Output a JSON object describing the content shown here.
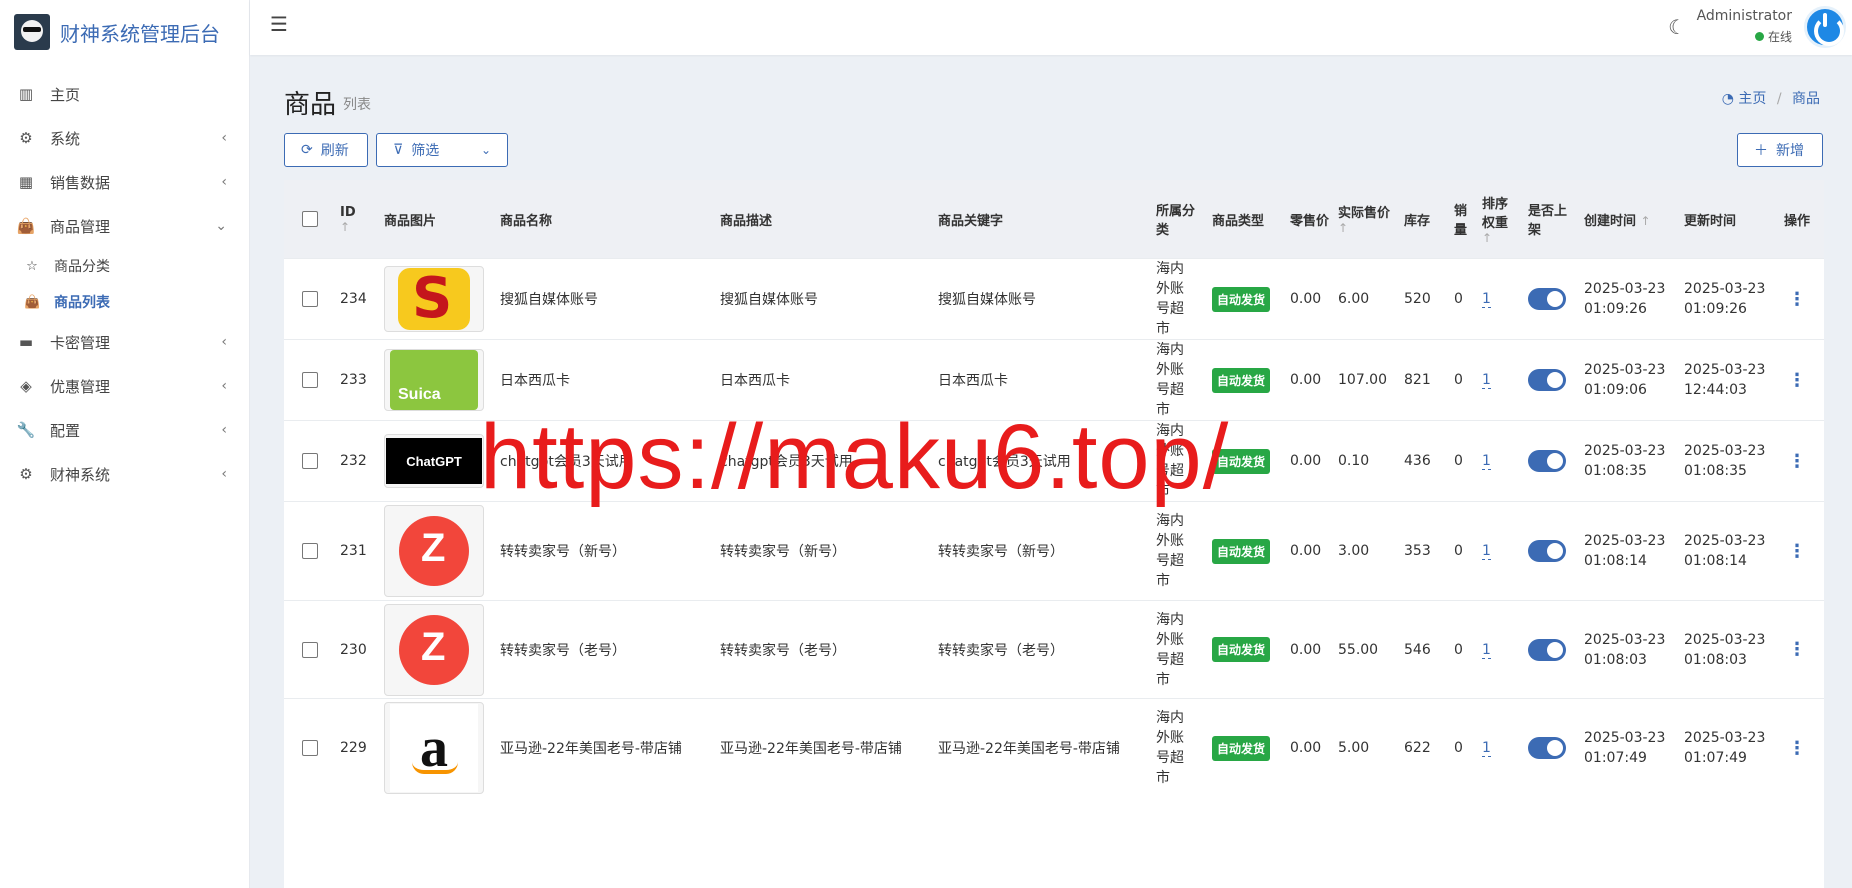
{
  "brand": {
    "title": "财神系统管理后台"
  },
  "sidebar": {
    "items": [
      {
        "icon": "bar-chart-icon",
        "glyph": "▥",
        "label": "主页"
      },
      {
        "icon": "gear-icon",
        "glyph": "⚙",
        "label": "系统"
      },
      {
        "icon": "table-icon",
        "glyph": "▦",
        "label": "销售数据"
      },
      {
        "icon": "shopping-bag-icon",
        "glyph": "👜",
        "label": "商品管理"
      },
      {
        "icon": "card-icon",
        "glyph": "▬",
        "label": "卡密管理"
      },
      {
        "icon": "diamond-icon",
        "glyph": "◈",
        "label": "优惠管理"
      },
      {
        "icon": "wrench-icon",
        "glyph": "🔧",
        "label": "配置"
      },
      {
        "icon": "gear-icon",
        "glyph": "⚙",
        "label": "财神系统"
      }
    ],
    "sub_items": [
      {
        "icon": "star-icon",
        "glyph": "☆",
        "label": "商品分类"
      },
      {
        "icon": "shopping-bag-icon",
        "glyph": "👜",
        "label": "商品列表"
      }
    ]
  },
  "header": {
    "user_name": "Administrator",
    "user_status": "在线",
    "status_color": "#28a745"
  },
  "page": {
    "title": "商品",
    "subtitle": "列表"
  },
  "breadcrumb": {
    "home": "主页",
    "current": "商品"
  },
  "toolbar": {
    "refresh": "刷新",
    "filter": "筛选",
    "add": "新增"
  },
  "table": {
    "headers": {
      "id": "ID",
      "img": "商品图片",
      "name": "商品名称",
      "desc": "商品描述",
      "kw": "商品关键字",
      "cat": "所属分类",
      "type": "商品类型",
      "retail": "零售价",
      "actual": "实际售价",
      "stock": "库存",
      "sales": "销量",
      "sort": "排序权重",
      "on_shelf": "是否上架",
      "created": "创建时间",
      "updated": "更新时间",
      "op": "操作"
    },
    "rows": [
      {
        "id": "234",
        "img": "sohu",
        "name": "搜狐自媒体账号",
        "desc": "搜狐自媒体账号",
        "kw": "搜狐自媒体账号",
        "cat": "海内外账号超市",
        "type": "自动发货",
        "retail": "0.00",
        "actual": "6.00",
        "stock": "520",
        "sales": "0",
        "sort": "1",
        "created_d": "2025-03-23",
        "created_t": "01:09:26",
        "updated_d": "2025-03-23",
        "updated_t": "01:09:26"
      },
      {
        "id": "233",
        "img": "suica",
        "name": "日本西瓜卡",
        "desc": "日本西瓜卡",
        "kw": "日本西瓜卡",
        "cat": "海内外账号超市",
        "type": "自动发货",
        "retail": "0.00",
        "actual": "107.00",
        "stock": "821",
        "sales": "0",
        "sort": "1",
        "created_d": "2025-03-23",
        "created_t": "01:09:06",
        "updated_d": "2025-03-23",
        "updated_t": "12:44:03"
      },
      {
        "id": "232",
        "img": "gpt",
        "name": "chatgpt会员3天试用",
        "desc": "chatgpt会员3天试用",
        "kw": "chatgpt会员3天试用",
        "cat": "海内外账号超市",
        "type": "自动发货",
        "retail": "0.00",
        "actual": "0.10",
        "stock": "436",
        "sales": "0",
        "sort": "1",
        "created_d": "2025-03-23",
        "created_t": "01:08:35",
        "updated_d": "2025-03-23",
        "updated_t": "01:08:35"
      },
      {
        "id": "231",
        "img": "zz",
        "name": "转转卖家号（新号）",
        "desc": "转转卖家号（新号）",
        "kw": "转转卖家号（新号）",
        "cat": "海内外账号超市",
        "type": "自动发货",
        "retail": "0.00",
        "actual": "3.00",
        "stock": "353",
        "sales": "0",
        "sort": "1",
        "created_d": "2025-03-23",
        "created_t": "01:08:14",
        "updated_d": "2025-03-23",
        "updated_t": "01:08:14"
      },
      {
        "id": "230",
        "img": "zz",
        "name": "转转卖家号（老号）",
        "desc": "转转卖家号（老号）",
        "kw": "转转卖家号（老号）",
        "cat": "海内外账号超市",
        "type": "自动发货",
        "retail": "0.00",
        "actual": "55.00",
        "stock": "546",
        "sales": "0",
        "sort": "1",
        "created_d": "2025-03-23",
        "created_t": "01:08:03",
        "updated_d": "2025-03-23",
        "updated_t": "01:08:03"
      },
      {
        "id": "229",
        "img": "amz",
        "name": "亚马逊-22年美国老号-带店铺",
        "desc": "亚马逊-22年美国老号-带店铺",
        "kw": "亚马逊-22年美国老号-带店铺",
        "cat": "海内外账号超市",
        "type": "自动发货",
        "retail": "0.00",
        "actual": "5.00",
        "stock": "622",
        "sales": "0",
        "sort": "1",
        "created_d": "2025-03-23",
        "created_t": "01:07:49",
        "updated_d": "2025-03-23",
        "updated_t": "01:07:49"
      }
    ]
  },
  "thumbs": {
    "suica_text": "Suica",
    "gpt_text": "ChatGPT",
    "amz_text": "a"
  },
  "watermark": "https://maku6.top/"
}
